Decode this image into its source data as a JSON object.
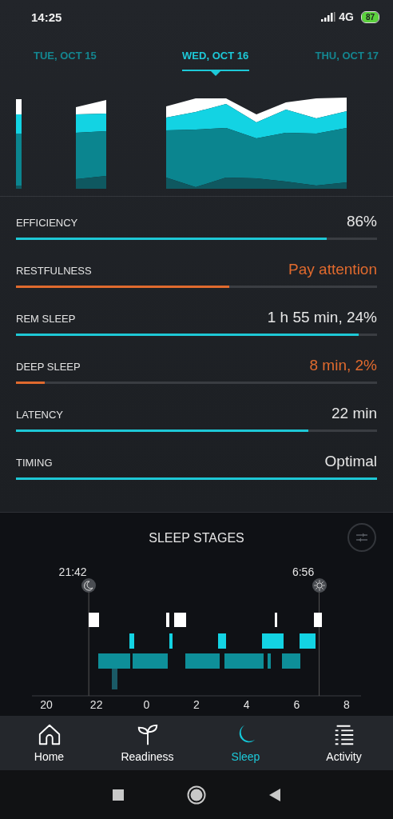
{
  "status_bar": {
    "time": "14:25",
    "network": "4G",
    "battery": "87"
  },
  "days": [
    {
      "label": "TUE, OCT 15",
      "selected": false
    },
    {
      "label": "WED, OCT 16",
      "selected": true
    },
    {
      "label": "THU, OCT 17",
      "selected": false
    }
  ],
  "metrics": [
    {
      "name": "EFFICIENCY",
      "value": "86%",
      "level": 0.86,
      "attention": false
    },
    {
      "name": "RESTFULNESS",
      "value": "Pay attention",
      "level": 0.59,
      "attention": true
    },
    {
      "name": "REM SLEEP",
      "value": "1 h 55 min, 24%",
      "level": 0.95,
      "attention": false
    },
    {
      "name": "DEEP SLEEP",
      "value": "8 min, 2%",
      "level": 0.08,
      "attention": true
    },
    {
      "name": "LATENCY",
      "value": "22 min",
      "level": 0.81,
      "attention": false
    },
    {
      "name": "TIMING",
      "value": "Optimal",
      "level": 1.0,
      "attention": false
    }
  ],
  "sleep_stages": {
    "title": "SLEEP STAGES",
    "bedtime": "21:42",
    "wake_time": "6:56",
    "axis_labels": [
      "20",
      "22",
      "0",
      "2",
      "4",
      "6",
      "8"
    ]
  },
  "nav": [
    {
      "label": "Home",
      "kind": "home",
      "selected": false
    },
    {
      "label": "Readiness",
      "kind": "readiness",
      "selected": false
    },
    {
      "label": "Sleep",
      "kind": "sleep",
      "selected": true
    },
    {
      "label": "Activity",
      "kind": "activity",
      "selected": false
    }
  ]
}
